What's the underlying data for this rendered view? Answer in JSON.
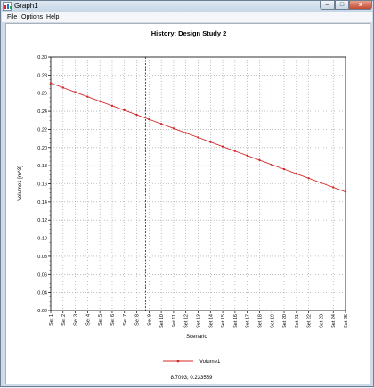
{
  "window": {
    "title": "Graph1",
    "buttons": {
      "minimize": "–",
      "maximize": "□",
      "close": "x"
    }
  },
  "menu": [
    {
      "label": "File",
      "key": "F",
      "rest": "ile"
    },
    {
      "label": "Options",
      "key": "O",
      "rest": "ptions"
    },
    {
      "label": "Help",
      "key": "H",
      "rest": "elp"
    }
  ],
  "readout": "8.7093, 0.233559",
  "colors": {
    "series": "#d42a2a",
    "grid": "#9a9a9a",
    "crosshair": "#000000"
  },
  "chart_data": {
    "type": "line",
    "title": "History: Design Study 2",
    "xlabel": "Scenario",
    "ylabel": "Volume1 [m^3]",
    "categories": [
      "Set 1",
      "Set 2",
      "Set 3",
      "Set 4",
      "Set 5",
      "Set 6",
      "Set 7",
      "Set 8",
      "Set 9",
      "Set 10",
      "Set 11",
      "Set 12",
      "Set 13",
      "Set 14",
      "Set 15",
      "Set 16",
      "Set 17",
      "Set 18",
      "Set 19",
      "Set 20",
      "Set 21",
      "Set 22",
      "Set 23",
      "Set 24",
      "Set 25"
    ],
    "series": [
      {
        "name": "Volume1",
        "values": [
          0.2711,
          0.2661,
          0.2611,
          0.2561,
          0.2511,
          0.2461,
          0.2411,
          0.2361,
          0.2311,
          0.2261,
          0.2211,
          0.2161,
          0.2111,
          0.2061,
          0.2011,
          0.1961,
          0.1911,
          0.1861,
          0.1811,
          0.1761,
          0.1711,
          0.1661,
          0.1611,
          0.1561,
          0.1511
        ]
      }
    ],
    "ylim": [
      0.02,
      0.3
    ],
    "yticks": [
      "0.02",
      "0.04",
      "0.06",
      "0.08",
      "0.10",
      "0.12",
      "0.14",
      "0.16",
      "0.18",
      "0.20",
      "0.22",
      "0.24",
      "0.26",
      "0.28",
      "0.30"
    ],
    "grid": true,
    "legend": "bottom-center",
    "crosshair": {
      "x": 8.7093,
      "y": 0.233559
    }
  }
}
